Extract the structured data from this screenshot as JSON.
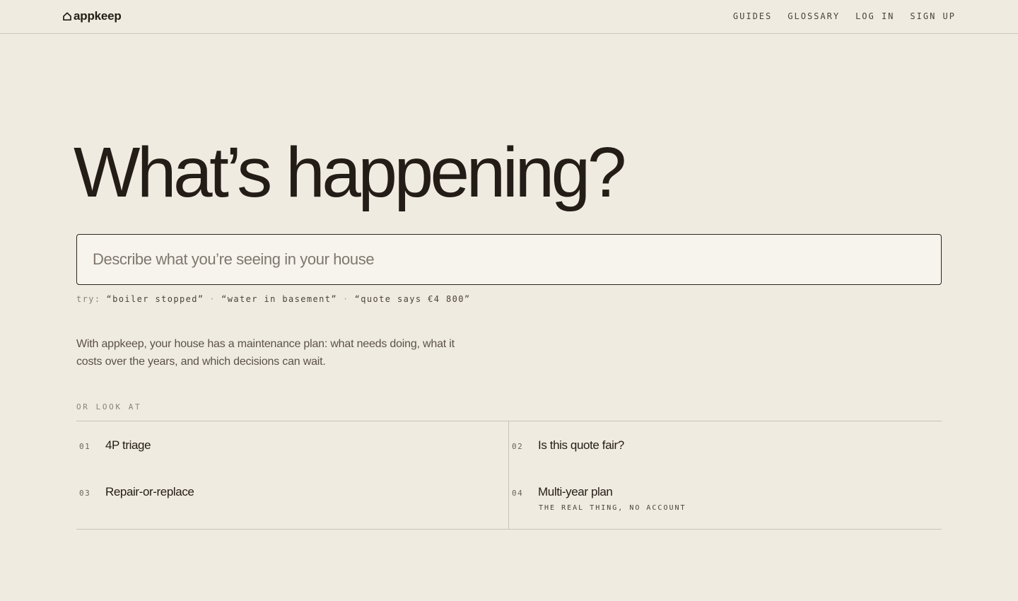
{
  "brand": {
    "name": "appkeep",
    "icon": "house-icon"
  },
  "nav": [
    "GUIDES",
    "GLOSSARY",
    "LOG IN",
    "SIGN UP"
  ],
  "hero": {
    "title": "What’s happening?"
  },
  "search": {
    "placeholder": "Describe what you’re seeing in your house",
    "value": ""
  },
  "suggestions": {
    "label": "try:",
    "items": [
      "“boiler stopped”",
      "“water in basement”",
      "“quote says €4 800”"
    ],
    "separator": "·"
  },
  "intro": "With appkeep, your house has a maintenance plan: what needs doing, what it costs over the years, and which decisions can wait.",
  "look_at": {
    "label": "OR LOOK AT",
    "items": [
      {
        "num": "01",
        "title": "4P triage",
        "sub": ""
      },
      {
        "num": "02",
        "title": "Is this quote fair?",
        "sub": ""
      },
      {
        "num": "03",
        "title": "Repair-or-replace",
        "sub": ""
      },
      {
        "num": "04",
        "title": "Multi-year plan",
        "sub": "THE REAL THING, NO ACCOUNT"
      }
    ]
  },
  "colors": {
    "background": "#f0ebe0",
    "text": "#231c17",
    "input_bg": "#f7f4ed",
    "border": "#c9c2b6"
  }
}
